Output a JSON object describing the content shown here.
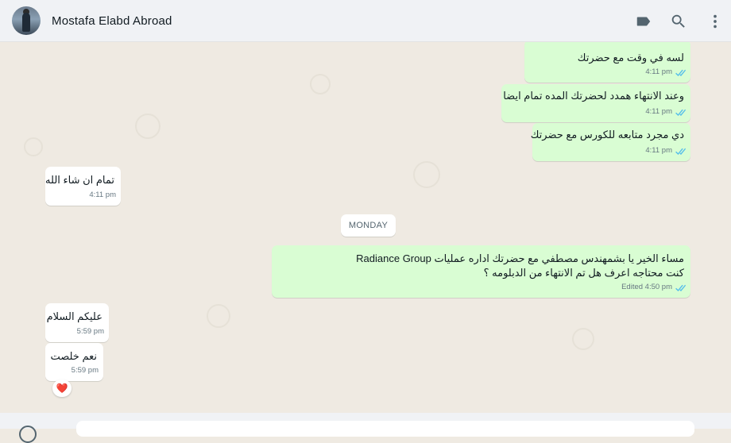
{
  "header": {
    "contact_name": "Mostafa Elabd Abroad",
    "icons": [
      "label-icon",
      "search-icon",
      "more-vertical-icon"
    ]
  },
  "date_divider": "MONDAY",
  "messages": [
    {
      "direction": "out",
      "text": "لسه في وقت مع حضرتك",
      "time": "4:11 pm",
      "status": "read"
    },
    {
      "direction": "out",
      "text": "وعند الانتهاء همدد لحضرتك المده تمام ايضا",
      "time": "4:11 pm",
      "status": "read"
    },
    {
      "direction": "out",
      "text": "دي مجرد متابعه للكورس مع حضرتك",
      "time": "4:11 pm",
      "status": "read"
    },
    {
      "direction": "in",
      "text": "تمام ان شاء الله",
      "time": "4:11 pm"
    },
    {
      "direction": "out",
      "text_line1": "مساء الخير يا بشمهندس مصطفي مع حضرتك اداره عمليات Radiance Group",
      "text_line2": "كنت محتاجه اعرف هل تم  الانتهاء من الدبلومه ؟",
      "time": "Edited 4:50 pm",
      "status": "read"
    },
    {
      "direction": "in",
      "text": "عليكم السلام",
      "time": "5:59 pm"
    },
    {
      "direction": "in",
      "text": "نعم خلصت",
      "time": "5:59 pm",
      "reaction": "❤️"
    }
  ],
  "colors": {
    "outgoing_bubble": "#d9fdd3",
    "incoming_bubble": "#ffffff",
    "chat_background": "#efeae2",
    "read_tick": "#53bdeb"
  }
}
